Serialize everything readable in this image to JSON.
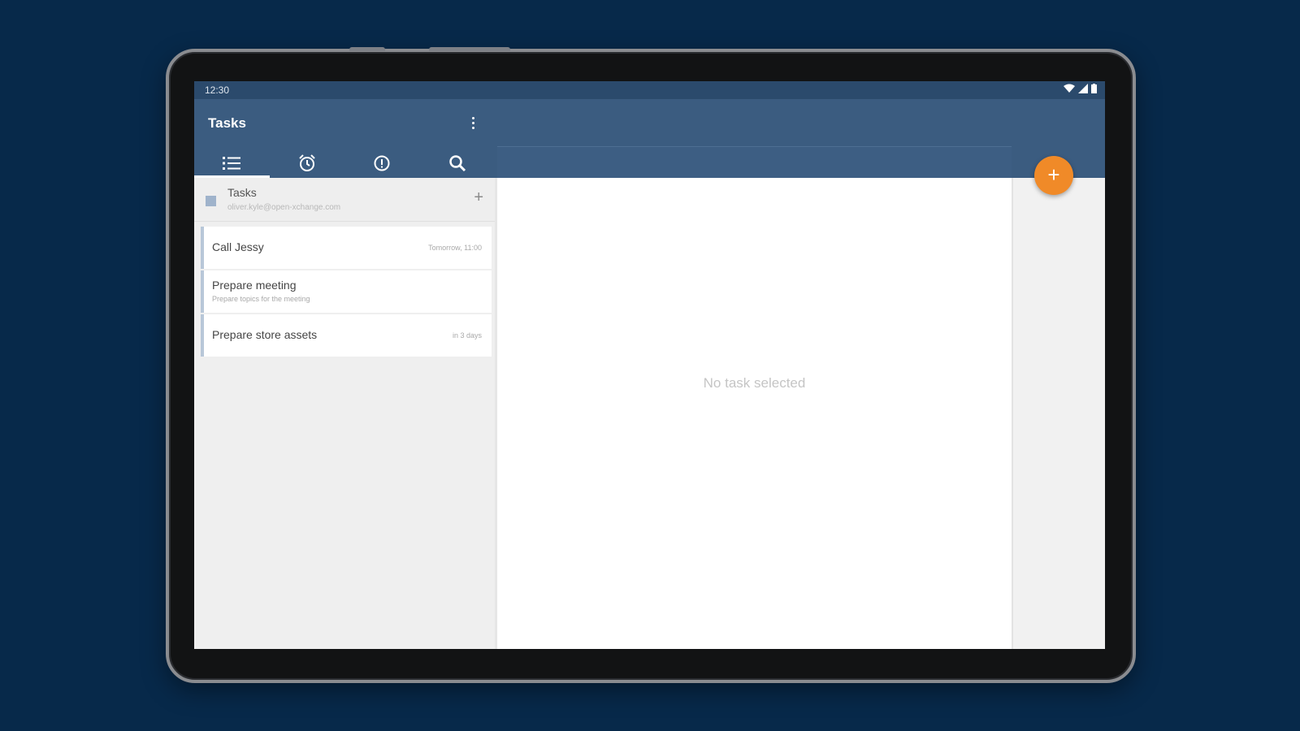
{
  "status_bar": {
    "time": "12:30"
  },
  "app": {
    "title": "Tasks"
  },
  "tabs": [
    {
      "name": "list",
      "icon": "list-icon",
      "active": true
    },
    {
      "name": "alarm",
      "icon": "alarm-clock-icon",
      "active": false
    },
    {
      "name": "priority",
      "icon": "priority-icon",
      "active": false
    },
    {
      "name": "search",
      "icon": "search-icon",
      "active": false
    }
  ],
  "task_list": {
    "name": "Tasks",
    "account": "oliver.kyle@open-xchange.com",
    "color": "#9fb3cb",
    "add_label": "+"
  },
  "tasks": [
    {
      "title": "Call Jessy",
      "subtitle": "",
      "due": "Tomorrow, 11:00"
    },
    {
      "title": "Prepare meeting",
      "subtitle": "Prepare topics for the meeting",
      "due": ""
    },
    {
      "title": "Prepare store assets",
      "subtitle": "",
      "due": "in 3 days"
    }
  ],
  "detail": {
    "empty_message": "No task selected"
  },
  "fab": {
    "label": "+",
    "color": "#f08a28"
  },
  "colors": {
    "primary": "#3b5c80",
    "status_bar": "#2b4a6c",
    "accent": "#f08a28",
    "background": "#07294a"
  }
}
